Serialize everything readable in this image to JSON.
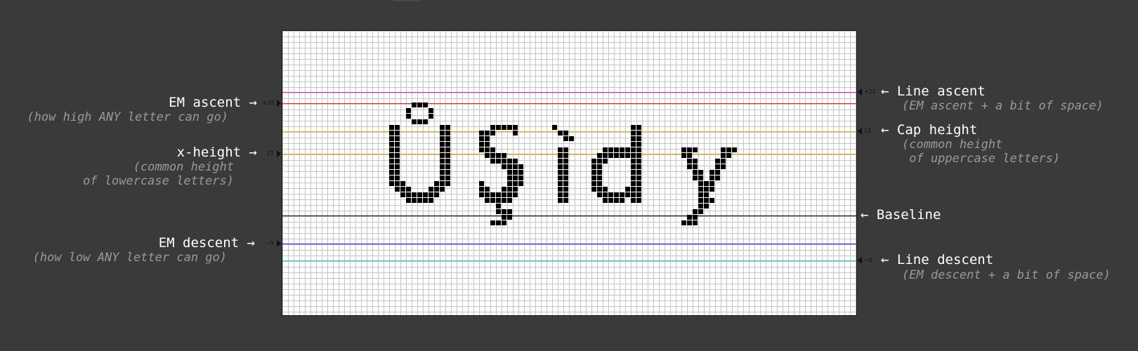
{
  "colors": {
    "background": "#3a3a3a",
    "line_ascent": "#d633d6",
    "em_ascent": "#e0202a",
    "cap_height": "#e8b400",
    "x_height": "#f0a000",
    "baseline": "#000000",
    "em_descent": "#1a1ad0",
    "line_descent": "#22c7c7"
  },
  "glyph": {
    "text": "Ůşidy",
    "pixel_color": "#000000"
  },
  "ticks": {
    "line_ascent": "+22",
    "em_ascent": "+20",
    "cap_height": "15",
    "x_height": "11",
    "em_descent": "−5",
    "line_descent": "−8"
  },
  "left_labels": {
    "em_ascent": {
      "title": "EM ascent →",
      "desc": "(how high ANY letter can go)"
    },
    "x_height": {
      "title": "x-height →",
      "desc": "(common height\nof lowercase letters)"
    },
    "em_descent": {
      "title": "EM descent →",
      "desc": "(how low ANY letter can go)"
    }
  },
  "right_labels": {
    "line_ascent": {
      "title": "← Line ascent",
      "desc": "(EM ascent + a bit of space)"
    },
    "cap_height": {
      "title": "← Cap height",
      "desc": "(common height\n of uppercase letters)"
    },
    "baseline": {
      "title": "← Baseline"
    },
    "line_descent": {
      "title": "← Line descent",
      "desc": "(EM descent + a bit of space)"
    }
  }
}
